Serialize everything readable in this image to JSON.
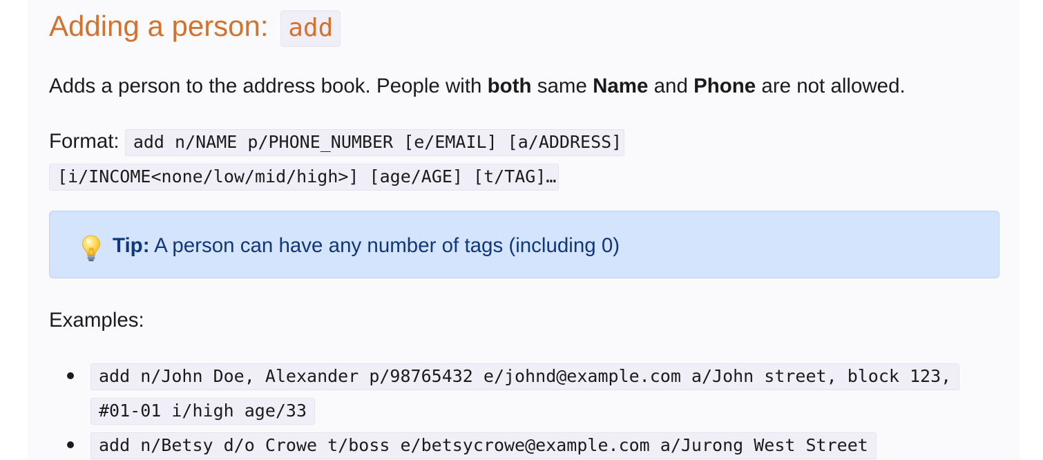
{
  "heading": {
    "text": "Adding a person:",
    "command": "add"
  },
  "intro": {
    "part1": "Adds a person to the address book. People with ",
    "bold1": "both",
    "part2": " same ",
    "bold2": "Name",
    "part3": " and ",
    "bold3": "Phone",
    "part4": " are not allowed."
  },
  "format": {
    "label": "Format:",
    "code": "add n/NAME p/PHONE_NUMBER [e/EMAIL] [a/ADDRESS] [i/INCOME<none/low/mid/high>] [age/AGE] [t/TAG]…"
  },
  "tip": {
    "icon": "lightbulb-icon",
    "label": "Tip:",
    "text": " A person can have any number of tags (including 0)"
  },
  "examples": {
    "label": "Examples:",
    "items": [
      "add n/John Doe, Alexander p/98765432 e/johnd@example.com a/John street, block 123, #01-01 i/high age/33",
      "add n/Betsy d/o Crowe t/boss e/betsycrowe@example.com a/Jurong West Street"
    ]
  },
  "colors": {
    "heading": "#d2722e",
    "tip_background": "#d4e4fc",
    "tip_text": "#10377a",
    "code_background": "#f0eff8"
  }
}
